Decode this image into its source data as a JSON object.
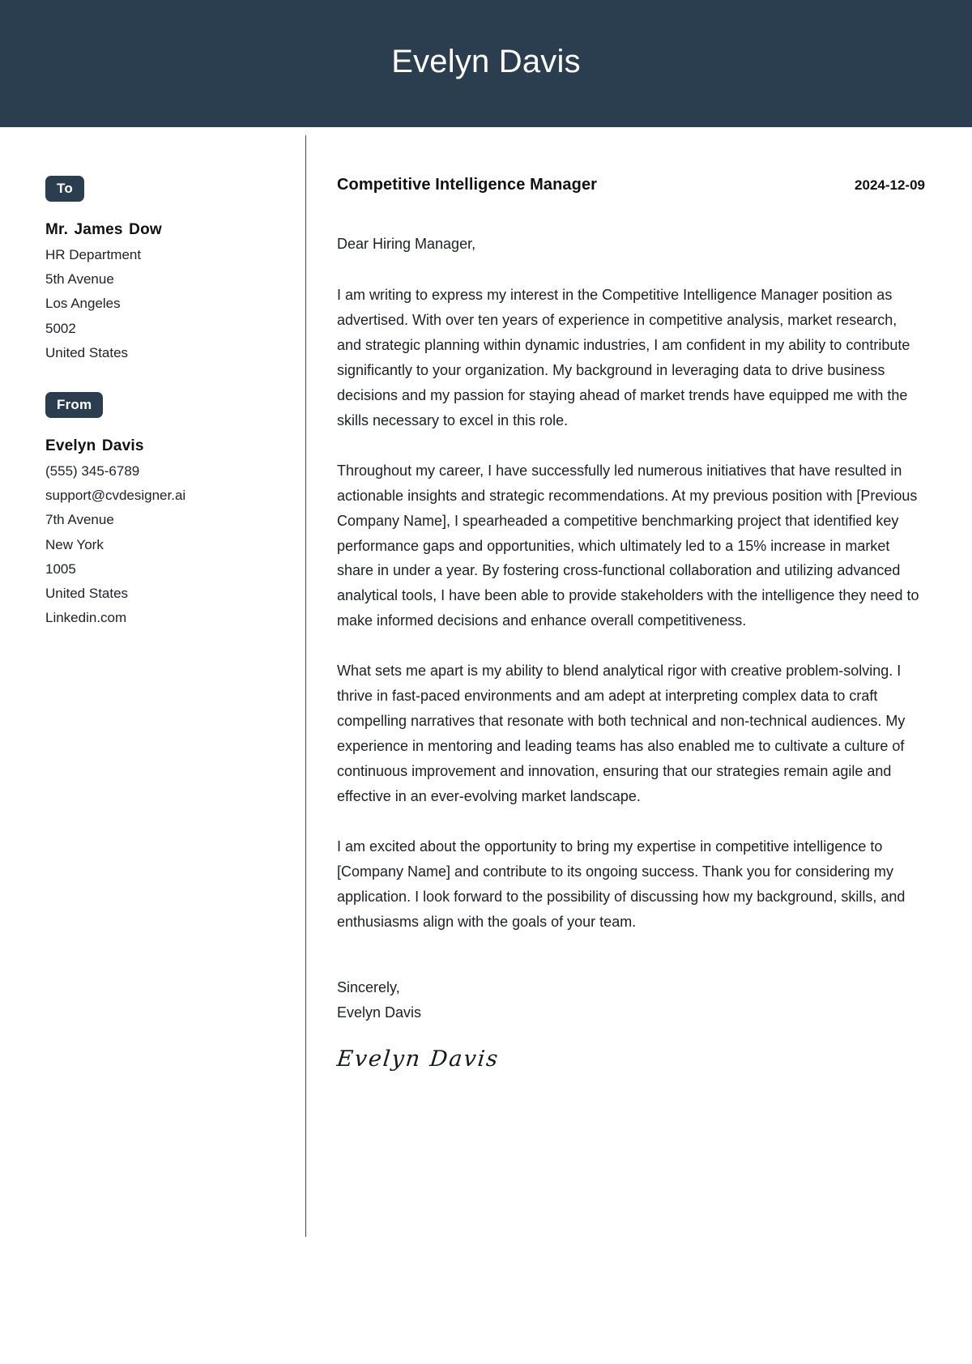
{
  "header": {
    "full_name": "Evelyn Davis",
    "background_color": "#2b3e50"
  },
  "sidebar": {
    "to": {
      "badge_label": "To",
      "recipient_name": "Mr. James Dow",
      "lines": [
        "HR Department",
        "5th Avenue",
        "Los Angeles",
        "5002",
        "United States"
      ]
    },
    "from": {
      "badge_label": "From",
      "sender_name": "Evelyn Davis",
      "lines": [
        "(555) 345-6789",
        "support@cvdesigner.ai",
        "7th Avenue",
        "New York",
        "1005",
        "United States",
        "Linkedin.com"
      ]
    }
  },
  "letter": {
    "job_title": "Competitive Intelligence Manager",
    "date": "2024-12-09",
    "salutation": "Dear Hiring Manager,",
    "paragraphs": [
      "I am writing to express my interest in the Competitive Intelligence Manager position as advertised. With over ten years of experience in competitive analysis, market research, and strategic planning within dynamic industries, I am confident in my ability to contribute significantly to your organization. My background in leveraging data to drive business decisions and my passion for staying ahead of market trends have equipped me with the skills necessary to excel in this role.",
      "Throughout my career, I have successfully led numerous initiatives that have resulted in actionable insights and strategic recommendations. At my previous position with [Previous Company Name], I spearheaded a competitive benchmarking project that identified key performance gaps and opportunities, which ultimately led to a 15% increase in market share in under a year. By fostering cross-functional collaboration and utilizing advanced analytical tools, I have been able to provide stakeholders with the intelligence they need to make informed decisions and enhance overall competitiveness.",
      "What sets me apart is my ability to blend analytical rigor with creative problem-solving. I thrive in fast-paced environments and am adept at interpreting complex data to craft compelling narratives that resonate with both technical and non-technical audiences. My experience in mentoring and leading teams has also enabled me to cultivate a culture of continuous improvement and innovation, ensuring that our strategies remain agile and effective in an ever-evolving market landscape.",
      "I am excited about the opportunity to bring my expertise in competitive intelligence to [Company Name] and contribute to its ongoing success. Thank you for considering my application. I look forward to the possibility of discussing how my background, skills, and enthusiasms align with the goals of your team."
    ],
    "closing_word": "Sincerely,",
    "closing_name": "Evelyn Davis",
    "signature": "Evelyn Davis"
  }
}
